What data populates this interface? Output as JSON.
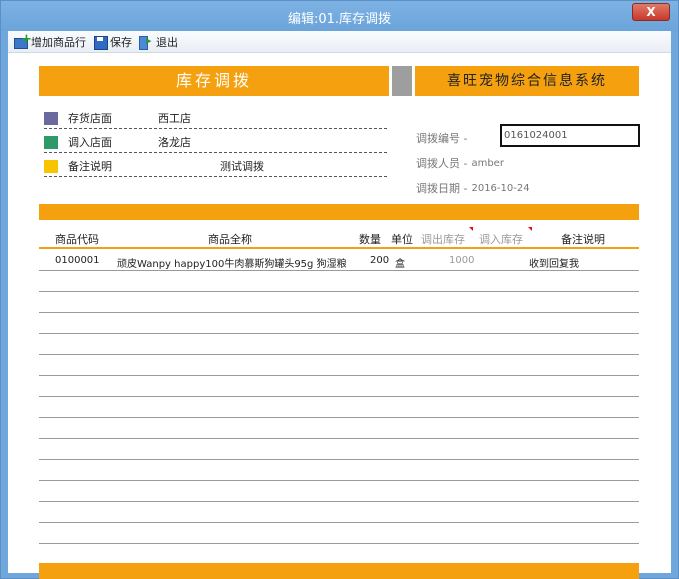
{
  "window": {
    "title": "编辑:01.库存调拨",
    "close_label": "X"
  },
  "toolbar": {
    "add_row_label": "增加商品行",
    "save_label": "保存",
    "exit_label": "退出"
  },
  "banner": {
    "left_title": "库存调拨",
    "right_title": "喜旺宠物综合信息系统"
  },
  "info": {
    "source_store_label": "存货店面",
    "source_store_value": "西工店",
    "target_store_label": "调入店面",
    "target_store_value": "洛龙店",
    "note_label": "备注说明",
    "note_value": "测试调拨"
  },
  "meta": {
    "doc_no_label": "调拨编号 -",
    "doc_no_value": "0161024001",
    "operator_label": "调拨人员 -",
    "operator_value": "amber",
    "date_label": "调拨日期 -",
    "date_value": "2016-10-24"
  },
  "table": {
    "headers": {
      "code": "商品代码",
      "name": "商品全称",
      "qty": "数量",
      "unit": "单位",
      "out_stock": "调出库存",
      "in_stock": "调入库存",
      "note": "备注说明"
    },
    "rows": [
      {
        "code": "0100001",
        "name": "顽皮Wanpy happy100牛肉慕斯狗罐头95g 狗湿粮",
        "qty": "200",
        "unit": "盒",
        "out_stock": "1000",
        "in_stock": "",
        "note": "收到回复我"
      }
    ]
  },
  "colors": {
    "accent": "#f5a10f",
    "swatch_source": "#6b6a9e",
    "swatch_target": "#2e9a6a",
    "swatch_note": "#f7c400",
    "title_bar": "#6fa6dc",
    "close_button": "#c7392c"
  }
}
